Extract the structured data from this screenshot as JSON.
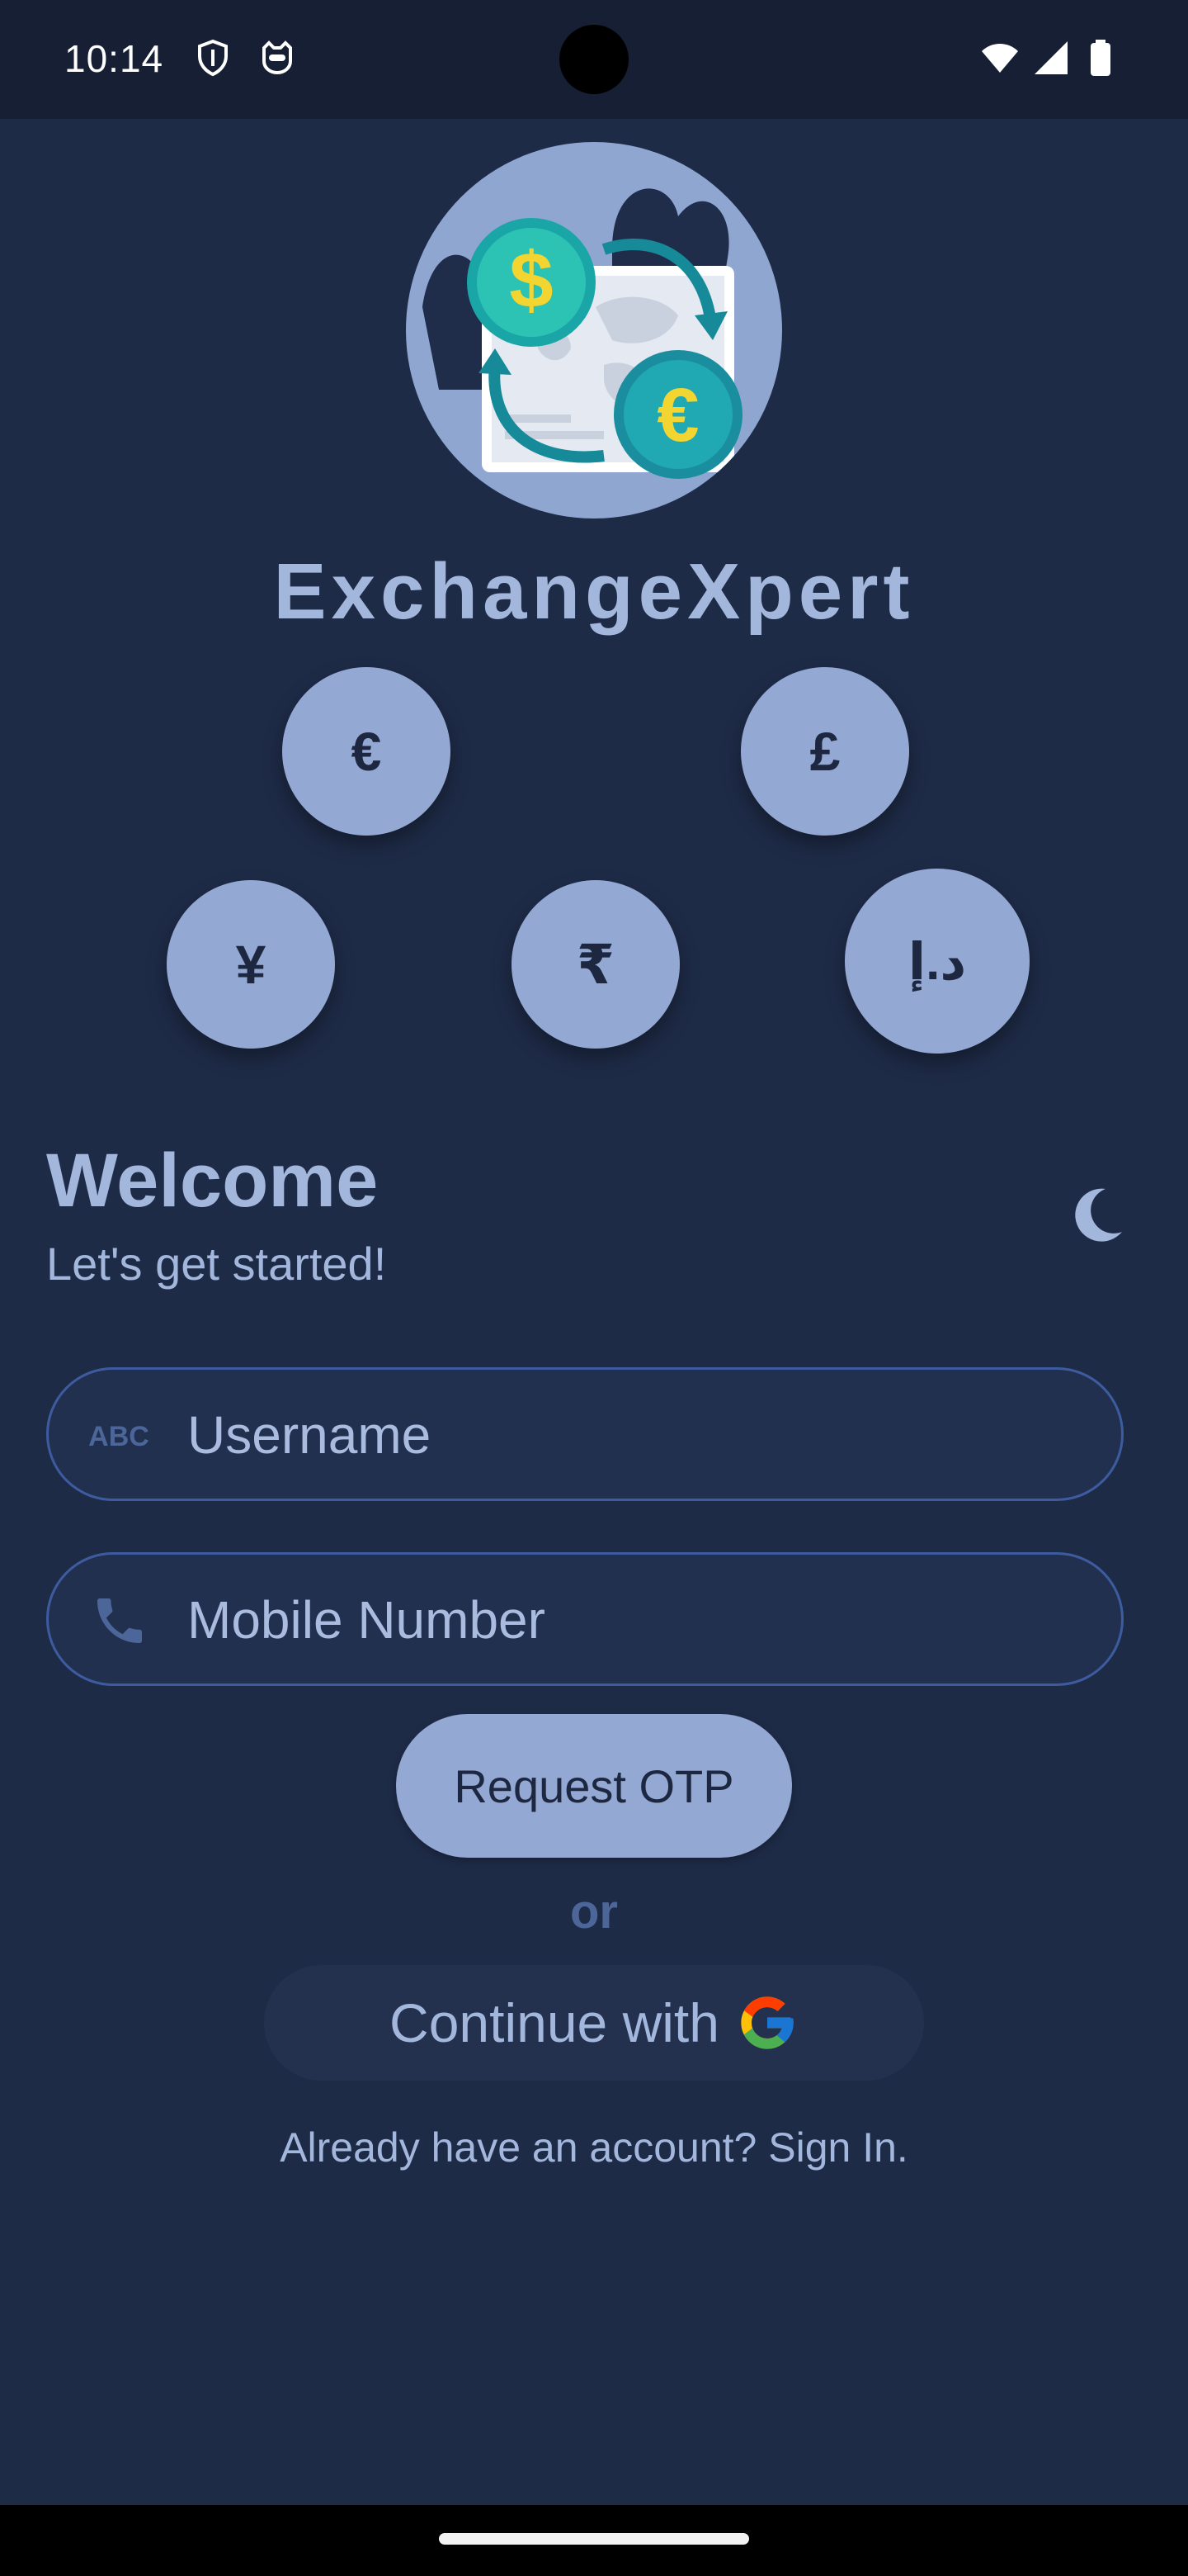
{
  "status_bar": {
    "time": "10:14",
    "icons": [
      "vpn-shield-icon",
      "cat-face-icon",
      "wifi-icon",
      "signal-icon",
      "battery-icon"
    ]
  },
  "app": {
    "name": "ExchangeXpert",
    "logo_icon": "currency-exchange-icon"
  },
  "currencies": [
    {
      "symbol": "€",
      "name": "euro"
    },
    {
      "symbol": "£",
      "name": "pound"
    },
    {
      "symbol": "¥",
      "name": "yen"
    },
    {
      "symbol": "₹",
      "name": "rupee"
    },
    {
      "symbol": "د.إ",
      "name": "dirham"
    }
  ],
  "welcome": {
    "title": "Welcome",
    "subtitle": "Let's get started!",
    "theme_icon": "moon-icon"
  },
  "form": {
    "username_placeholder": "Username",
    "username_icon": "abc-text-icon",
    "mobile_placeholder": "Mobile Number",
    "mobile_icon": "phone-icon",
    "request_otp_label": "Request OTP",
    "or_label": "or",
    "google_label": "Continue with",
    "google_icon": "google-icon",
    "signin_label": "Already have an account? Sign In."
  },
  "colors": {
    "background": "#1e2b47",
    "accent": "#93a8d3",
    "text": "#a3b6dc",
    "field_border": "#3d5ca0"
  }
}
